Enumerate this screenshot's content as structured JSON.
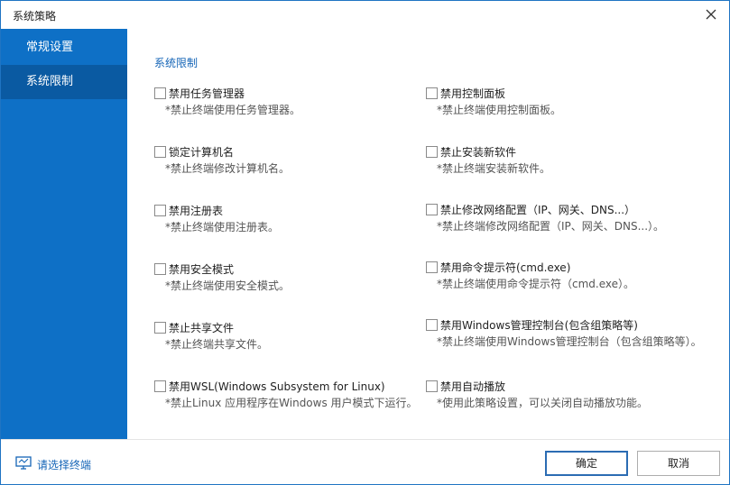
{
  "window": {
    "title": "系统策略"
  },
  "sidebar": {
    "items": [
      {
        "label": "常规设置"
      },
      {
        "label": "系统限制"
      }
    ]
  },
  "main": {
    "section_title": "系统限制",
    "left_options": [
      {
        "label": "禁用任务管理器",
        "desc": "*禁止终端使用任务管理器。"
      },
      {
        "label": "锁定计算机名",
        "desc": "*禁止终端修改计算机名。"
      },
      {
        "label": "禁用注册表",
        "desc": "*禁止终端使用注册表。"
      },
      {
        "label": "禁用安全模式",
        "desc": "*禁止终端使用安全模式。"
      },
      {
        "label": "禁止共享文件",
        "desc": "*禁止终端共享文件。"
      },
      {
        "label": "禁用WSL(Windows Subsystem for Linux)",
        "desc": "*禁止Linux 应用程序在Windows 用户模式下运行。"
      }
    ],
    "right_options": [
      {
        "label": "禁用控制面板",
        "desc": "*禁止终端使用控制面板。"
      },
      {
        "label": "禁止安装新软件",
        "desc": "*禁止终端安装新软件。"
      },
      {
        "label": "禁止修改网络配置（IP、网关、DNS...）",
        "desc": "*禁止终端修改网络配置（IP、网关、DNS...）。"
      },
      {
        "label": "禁用命令提示符(cmd.exe)",
        "desc": "*禁止终端使用命令提示符（cmd.exe）。"
      },
      {
        "label": "禁用Windows管理控制台(包含组策略等)",
        "desc": "*禁止终端使用Windows管理控制台（包含组策略等）。"
      },
      {
        "label": "禁用自动播放",
        "desc": "*使用此策略设置，可以关闭自动播放功能。"
      }
    ]
  },
  "footer": {
    "select_terminal": "请选择终端",
    "ok_label": "确定",
    "cancel_label": "取消"
  },
  "colors": {
    "accent": "#0e70c6",
    "selected": "#0a5aa2",
    "link": "#1565b7"
  },
  "icons": {
    "close": "close-icon",
    "terminal": "monitor-icon"
  }
}
